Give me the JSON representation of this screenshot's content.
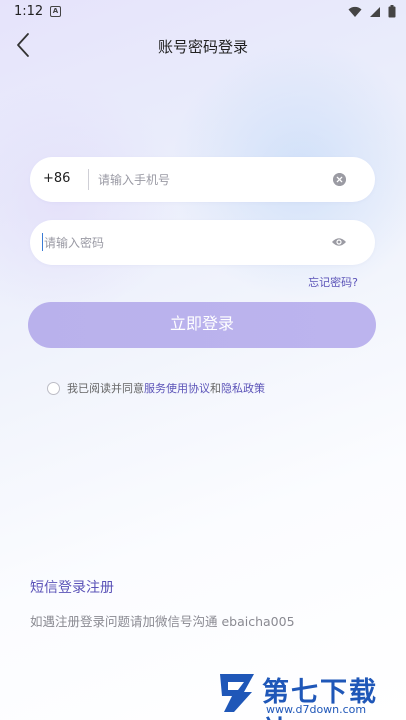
{
  "status_bar": {
    "time": "1:12",
    "notification_badge": "A",
    "icons": [
      "wifi-icon",
      "signal-icon",
      "battery-icon"
    ]
  },
  "header": {
    "title": "账号密码登录",
    "back_icon": "chevron-left-icon"
  },
  "phone_field": {
    "country_code": "+86",
    "placeholder": "请输入手机号",
    "clear_icon": "clear-icon"
  },
  "password_field": {
    "placeholder": "请输入密码",
    "toggle_icon": "eye-icon"
  },
  "forgot_password": "忘记密码?",
  "login_button": "立即登录",
  "agreement": {
    "prefix": "我已阅读并同意",
    "terms": "服务使用协议",
    "connector": "和",
    "privacy": "隐私政策"
  },
  "sms_login_link": "短信登录注册",
  "help_text": "如遇注册登录问题请加微信号沟通 ebaicha005",
  "watermark": {
    "title": "第七下载站",
    "url": "www.d7down.com"
  },
  "colors": {
    "accent": "#5b53b8",
    "button": "#bcb4ee",
    "watermark": "#1f57b8"
  }
}
